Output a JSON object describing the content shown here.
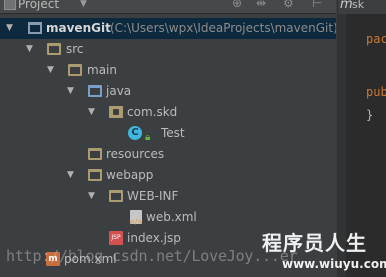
{
  "panel": {
    "title": "Project",
    "toolbar_icons": [
      "crosshair-icon",
      "split-icon",
      "gear-icon",
      "hide-icon"
    ]
  },
  "tree": {
    "root": {
      "name": "mavenGit",
      "path": "(C:\\Users\\wpx\\IdeaProjects\\mavenGit)"
    },
    "src": "src",
    "main": "main",
    "java": "java",
    "package": "com.skd",
    "class_name": "Test",
    "class_badge": "C",
    "resources": "resources",
    "webapp": "webapp",
    "webinf": "WEB-INF",
    "webxml": "web.xml",
    "indexjsp": "index.jsp",
    "pomxml": "pom.xml",
    "jsp_badge": "JSP",
    "maven_badge": "m"
  },
  "editor": {
    "tab_m": "m",
    "tab_text": "sk",
    "lines": [
      "pac",
      "pub",
      "}"
    ]
  },
  "watermark": {
    "url": "http://blog.csdn.net/LoveJoy...er",
    "site_cn": "程序员人生",
    "site_url": "www.wiuyu.com"
  },
  "colors": {
    "panel_bg": "#3c3f41",
    "selection_bg": "#0d293e",
    "editor_bg": "#2b2b2b",
    "keyword": "#cc7832"
  }
}
